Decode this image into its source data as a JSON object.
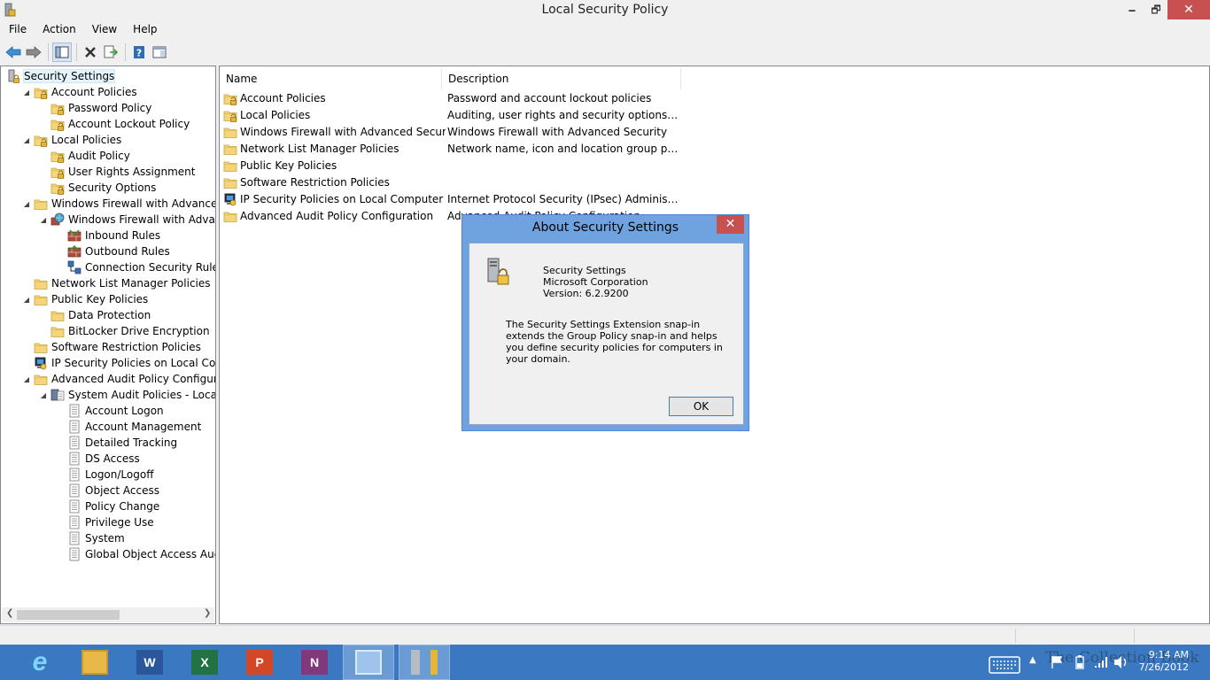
{
  "window": {
    "title": "Local Security Policy",
    "minimize_glyph": "🗕",
    "restore_glyph": "🗗",
    "close_glyph": "✕"
  },
  "menu": [
    "File",
    "Action",
    "View",
    "Help"
  ],
  "toolbar": {
    "buttons": [
      "back-arrow-icon",
      "forward-arrow-icon",
      "show-hide-tree-icon",
      "delete-icon",
      "export-list-icon",
      "help-icon",
      "properties-icon"
    ]
  },
  "tree": {
    "items": [
      {
        "label": "Security Settings",
        "icon": "security-settings-icon"
      },
      {
        "label": "Account Policies",
        "icon": "folder-lock-icon"
      },
      {
        "label": "Password Policy",
        "icon": "folder-lock-icon"
      },
      {
        "label": "Account Lockout Policy",
        "icon": "folder-lock-icon"
      },
      {
        "label": "Local Policies",
        "icon": "folder-lock-icon"
      },
      {
        "label": "Audit Policy",
        "icon": "folder-lock-icon"
      },
      {
        "label": "User Rights Assignment",
        "icon": "folder-lock-icon"
      },
      {
        "label": "Security Options",
        "icon": "folder-lock-icon"
      },
      {
        "label": "Windows Firewall with Advanced Secu",
        "icon": "folder-icon"
      },
      {
        "label": "Windows Firewall with Advanced S",
        "icon": "firewall-globe-icon"
      },
      {
        "label": "Inbound Rules",
        "icon": "inbound-rules-icon"
      },
      {
        "label": "Outbound Rules",
        "icon": "outbound-rules-icon"
      },
      {
        "label": "Connection Security Rules",
        "icon": "connection-security-icon"
      },
      {
        "label": "Network List Manager Policies",
        "icon": "folder-icon"
      },
      {
        "label": "Public Key Policies",
        "icon": "folder-icon"
      },
      {
        "label": "Data Protection",
        "icon": "folder-icon"
      },
      {
        "label": "BitLocker Drive Encryption",
        "icon": "folder-icon"
      },
      {
        "label": "Software Restriction Policies",
        "icon": "folder-icon"
      },
      {
        "label": "IP Security Policies on Local Compute",
        "icon": "ipsec-icon"
      },
      {
        "label": "Advanced Audit Policy Configuration",
        "icon": "folder-icon"
      },
      {
        "label": "System Audit Policies - Local Grou",
        "icon": "audit-policies-icon"
      },
      {
        "label": "Account Logon",
        "icon": "policy-doc-icon"
      },
      {
        "label": "Account Management",
        "icon": "policy-doc-icon"
      },
      {
        "label": "Detailed Tracking",
        "icon": "policy-doc-icon"
      },
      {
        "label": "DS Access",
        "icon": "policy-doc-icon"
      },
      {
        "label": "Logon/Logoff",
        "icon": "policy-doc-icon"
      },
      {
        "label": "Object Access",
        "icon": "policy-doc-icon"
      },
      {
        "label": "Policy Change",
        "icon": "policy-doc-icon"
      },
      {
        "label": "Privilege Use",
        "icon": "policy-doc-icon"
      },
      {
        "label": "System",
        "icon": "policy-doc-icon"
      },
      {
        "label": "Global Object Access Auditing",
        "icon": "policy-doc-icon"
      }
    ]
  },
  "list": {
    "columns": [
      "Name",
      "Description"
    ],
    "rows": [
      {
        "name": "Account Policies",
        "description": "Password and account lockout policies",
        "icon": "folder-lock-icon"
      },
      {
        "name": "Local Policies",
        "description": "Auditing, user rights and security options polici...",
        "icon": "folder-lock-icon"
      },
      {
        "name": "Windows Firewall with Advanced Security",
        "description": "Windows Firewall with Advanced Security",
        "icon": "folder-icon"
      },
      {
        "name": "Network List Manager Policies",
        "description": "Network name, icon and location group policies.",
        "icon": "folder-icon"
      },
      {
        "name": "Public Key Policies",
        "description": "",
        "icon": "folder-icon"
      },
      {
        "name": "Software Restriction Policies",
        "description": "",
        "icon": "folder-icon"
      },
      {
        "name": "IP Security Policies on Local Computer",
        "description": "Internet Protocol Security (IPsec) Administratio...",
        "icon": "ipsec-icon"
      },
      {
        "name": "Advanced Audit Policy Configuration",
        "description": "Advanced Audit Policy Configuration",
        "icon": "folder-icon"
      }
    ]
  },
  "dialog": {
    "title": "About Security Settings",
    "close_glyph": "✕",
    "product": "Security Settings",
    "company": "Microsoft Corporation",
    "version": "Version: 6.2.9200",
    "description": "The Security Settings Extension snap-in extends the Group Policy snap-in and helps you define security policies for computers in your domain.",
    "ok_label": "OK"
  },
  "taskbar": {
    "apps": [
      {
        "name": "internet-explorer",
        "letter": "e",
        "color": "#3a79c1"
      },
      {
        "name": "file-explorer",
        "letter": "",
        "color": "#e8b949"
      },
      {
        "name": "word",
        "letter": "W",
        "color": "#2b579a"
      },
      {
        "name": "excel",
        "letter": "X",
        "color": "#217346"
      },
      {
        "name": "powerpoint",
        "letter": "P",
        "color": "#d24726"
      },
      {
        "name": "onenote",
        "letter": "N",
        "color": "#80397b"
      },
      {
        "name": "control-panel",
        "letter": "",
        "color": "#6b9bd4"
      },
      {
        "name": "local-security-policy",
        "letter": "",
        "color": "#6b9bd4"
      }
    ],
    "watermark": "The Collection Book",
    "time": "9:14 AM",
    "date": "7/26/2012"
  }
}
